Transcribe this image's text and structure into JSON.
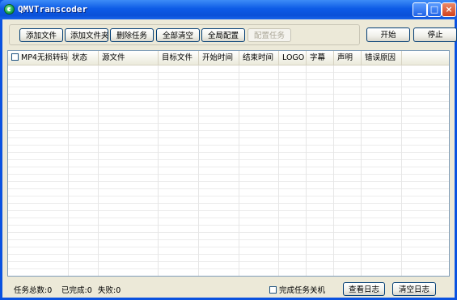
{
  "window": {
    "title": "QMVTranscoder"
  },
  "toolbar": {
    "add_file": "添加文件",
    "add_folder": "添加文件夹",
    "delete_task": "删除任务",
    "clear_all": "全部清空",
    "global_config": "全局配置",
    "config_task": "配置任务",
    "start": "开始",
    "stop": "停止"
  },
  "table": {
    "columns": [
      "MP4无损转码",
      "状态",
      "源文件",
      "目标文件",
      "开始时间",
      "结束时间",
      "LOGO",
      "字幕",
      "声明",
      "错误原因"
    ],
    "rows": []
  },
  "status": {
    "total": "任务总数:0",
    "done": "已完成:0",
    "failed": "失败:0",
    "shutdown_label": "完成任务关机",
    "view_log": "查看日志",
    "clear_log": "清空日志"
  },
  "colors": {
    "titlebar": "#0a50d8",
    "client_bg": "#ece9d8",
    "border": "#7f9db9"
  }
}
